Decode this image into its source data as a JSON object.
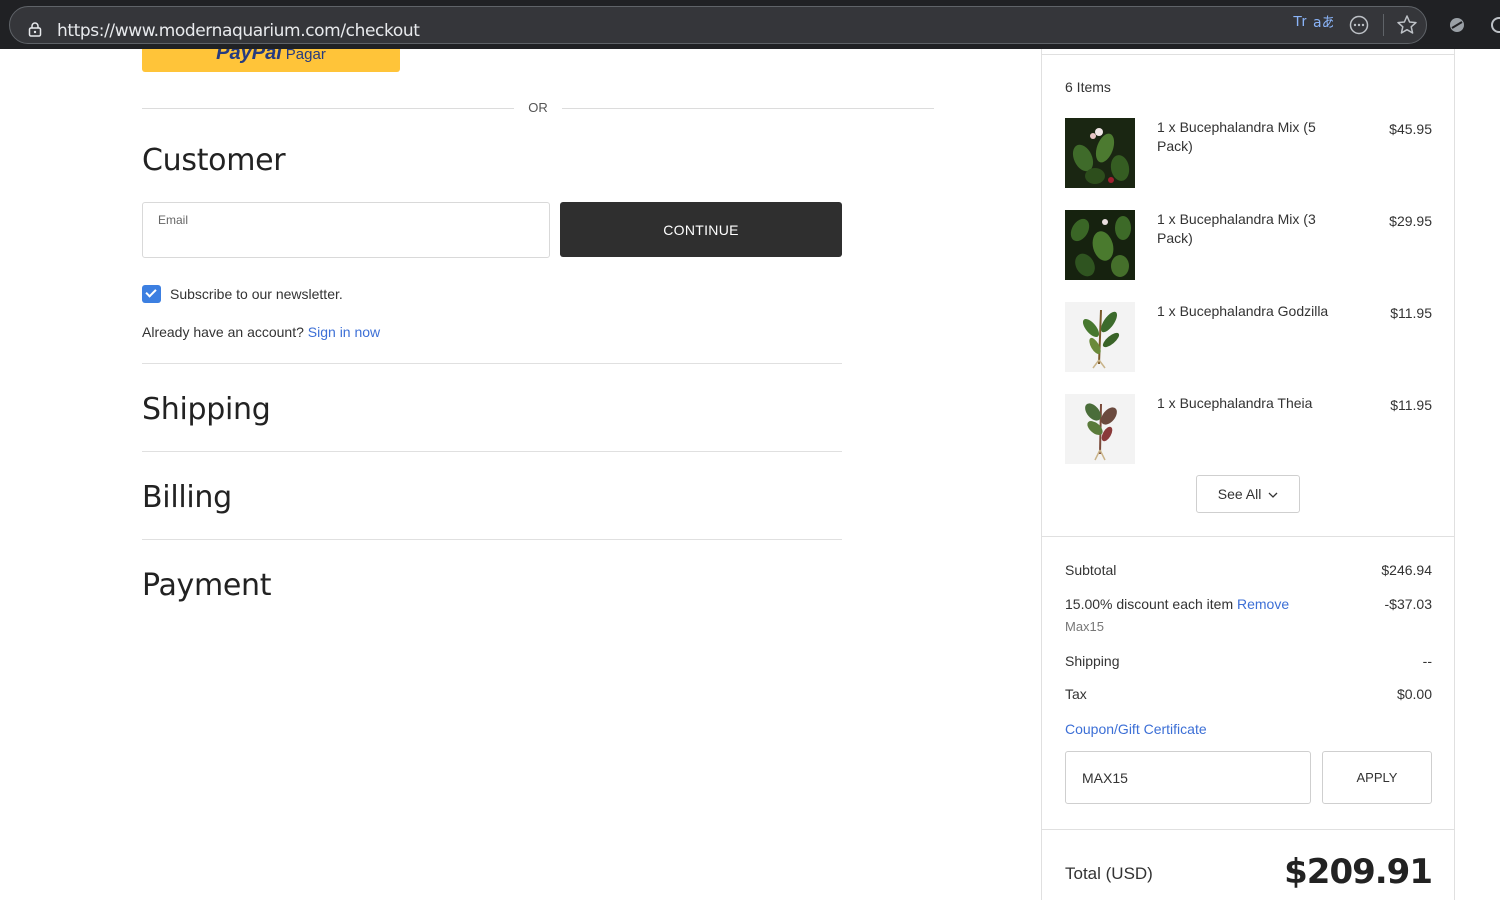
{
  "browser": {
    "url": "https://www.modernaquarium.com/checkout",
    "translate_label": "Tr",
    "read_aloud_label": "a𝔞"
  },
  "paypal": {
    "brand": "PayPal",
    "label": "Pagar"
  },
  "divider_or": "OR",
  "customer": {
    "title": "Customer",
    "email_label": "Email",
    "continue_label": "CONTINUE",
    "newsletter_label": "Subscribe to our newsletter.",
    "newsletter_checked": true,
    "account_prompt": "Already have an account?",
    "signin_label": "Sign in now"
  },
  "sections": {
    "shipping": "Shipping",
    "billing": "Billing",
    "payment": "Payment"
  },
  "summary": {
    "items_count": "6 Items",
    "items": [
      {
        "name": "1 x Bucephalandra Mix (5 Pack)",
        "price": "$45.95"
      },
      {
        "name": "1 x Bucephalandra Mix (3 Pack)",
        "price": "$29.95"
      },
      {
        "name": "1 x Bucephalandra Godzilla",
        "price": "$11.95"
      },
      {
        "name": "1 x Bucephalandra Theia",
        "price": "$11.95"
      }
    ],
    "see_all_label": "See All",
    "subtotal_label": "Subtotal",
    "subtotal_value": "$246.94",
    "discount_label": "15.00% discount each item",
    "discount_remove_label": "Remove",
    "discount_value": "-$37.03",
    "discount_code": "Max15",
    "shipping_label": "Shipping",
    "shipping_value": "--",
    "tax_label": "Tax",
    "tax_value": "$0.00",
    "coupon_link": "Coupon/Gift Certificate",
    "coupon_value": "MAX15",
    "apply_label": "APPLY",
    "total_label": "Total (USD)",
    "total_value": "$209.91"
  },
  "colors": {
    "accent": "#3c6fd6",
    "button_dark": "#2f2f2f",
    "paypal_yellow": "#ffc439"
  }
}
